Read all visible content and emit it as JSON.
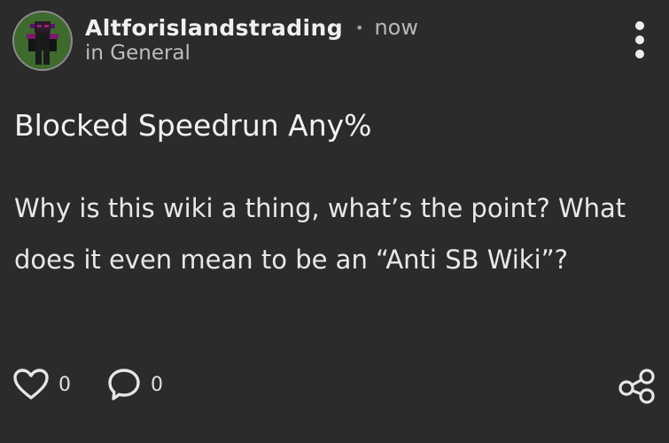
{
  "post": {
    "author": "Altforislandstrading",
    "separator": "•",
    "timestamp": "now",
    "community": "in General",
    "title": "Blocked Speedrun Any%",
    "body": "Why is this wiki a thing, what’s the point? What does it even mean to be an “Anti SB Wiki”?",
    "likes": "0",
    "comments": "0"
  },
  "icons": {
    "like": "heart-outline-icon",
    "comment": "speech-bubble-outline-icon",
    "share": "share-icon",
    "more": "vertical-ellipsis-icon"
  },
  "colors": {
    "background": "#2b2b2b",
    "text": "#e8e8e8",
    "muted": "#b8b8b8",
    "avatar_bg": "#3f6a2e"
  }
}
